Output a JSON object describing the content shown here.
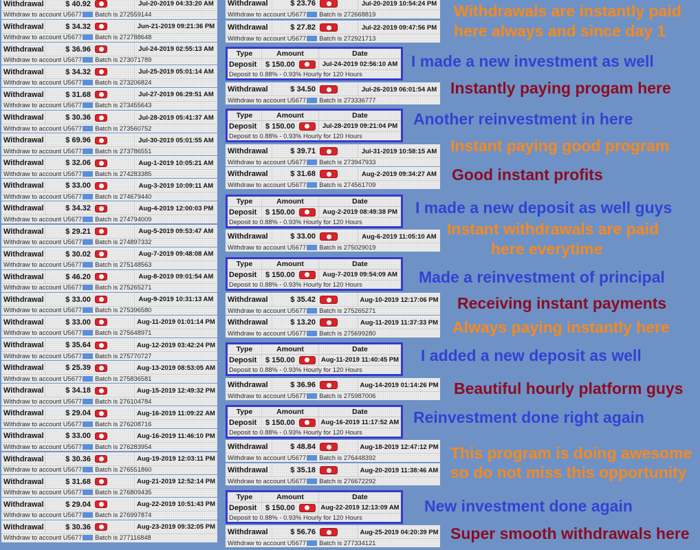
{
  "colors": {
    "page_background": "#6e92c6",
    "card_background": "#ededed",
    "deposit_border": "#3838cc",
    "account_redaction": "#5b8fd9",
    "payment_icon": "#d9232a"
  },
  "icons": {
    "payment": "perfect-money-icon"
  },
  "labels": {
    "withdrawal": "Withdrawal",
    "account": "Withdraw to account U5677",
    "deposit_type": "Deposit",
    "deposit_plan": "Deposit to 0.88% - 0.93% Hourly for 120 Hours"
  },
  "deposit_headers": {
    "type": "Type",
    "amount": "Amount",
    "date": "Date"
  },
  "left_withdrawals": [
    {
      "amount": "$ 40.92",
      "date": "Jul-20-2019 04:33:20 AM",
      "batch": "Batch is 272559144"
    },
    {
      "amount": "$ 34.32",
      "date": "Jun-21-2019 09:21:36 PM",
      "batch": "Batch is 272788648"
    },
    {
      "amount": "$ 36.96",
      "date": "Jul-24-2019 02:55:13 AM",
      "batch": "Batch is 273071789"
    },
    {
      "amount": "$ 34.32",
      "date": "Jul-25-2019 05:01:14 AM",
      "batch": "Batch is 273206824"
    },
    {
      "amount": "$ 31.68",
      "date": "Jul-27-2019 06:29:51 AM",
      "batch": "Batch is 273455643"
    },
    {
      "amount": "$ 30.36",
      "date": "Jul-28-2019 05:41:37 AM",
      "batch": "Batch is 273560752"
    },
    {
      "amount": "$ 69.96",
      "date": "Jul-30-2019 05:01:55 AM",
      "batch": "Batch is 273786551"
    },
    {
      "amount": "$ 32.06",
      "date": "Aug-1-2019 10:05:21 AM",
      "batch": "Batch is 274283385"
    },
    {
      "amount": "$ 33.00",
      "date": "Aug-3-2019 10:09:11 AM",
      "batch": "Batch is 274679440"
    },
    {
      "amount": "$ 34.32",
      "date": "Aug-4-2019 12:00:03 PM",
      "batch": "Batch is 274794009"
    },
    {
      "amount": "$ 29.21",
      "date": "Aug-5-2019 09:53:47 AM",
      "batch": "Batch is 274897332"
    },
    {
      "amount": "$ 30.02",
      "date": "Aug-7-2019 09:48:08 AM",
      "batch": "Batch is 275148563"
    },
    {
      "amount": "$ 46.20",
      "date": "Aug-8-2019 09:01:54 AM",
      "batch": "Batch is 275265271"
    },
    {
      "amount": "$ 33.00",
      "date": "Aug-9-2019 10:31:13 AM",
      "batch": "Batch is 275396580"
    },
    {
      "amount": "$ 33.00",
      "date": "Aug-11-2019 01:01:14 PM",
      "batch": "Batch is 275648971"
    },
    {
      "amount": "$ 35.64",
      "date": "Aug-12-2019 03:42:24 PM",
      "batch": "Batch is 275770727"
    },
    {
      "amount": "$ 25.39",
      "date": "Aug-13-2019 08:53:05 AM",
      "batch": "Batch is 275836581"
    },
    {
      "amount": "$ 34.18",
      "date": "Aug-15-2019 12:49:32 PM",
      "batch": "Batch is 276104784"
    },
    {
      "amount": "$ 29.04",
      "date": "Aug-16-2019 11:09:22 AM",
      "batch": "Batch is 276208716"
    },
    {
      "amount": "$ 33.00",
      "date": "Aug-16-2019 11:46:10 PM",
      "batch": "Batch is 276283954"
    },
    {
      "amount": "$ 30.36",
      "date": "Aug-19-2019 12:03:11 PM",
      "batch": "Batch is 276551860"
    },
    {
      "amount": "$ 31.68",
      "date": "Aug-21-2019 12:52:14 PM",
      "batch": "Batch is 276809435"
    },
    {
      "amount": "$ 29.04",
      "date": "Aug-22-2019 10:51:43 PM",
      "batch": "Batch is 276997874"
    },
    {
      "amount": "$ 30.36",
      "date": "Aug-23-2019 09:32:05 PM",
      "batch": "Batch is 277116848"
    }
  ],
  "middle_feed": [
    {
      "amount": "$ 23.76",
      "date": "Jul-20-2019 10:54:24 PM",
      "batch": "Batch is 272668819"
    },
    {
      "amount": "$ 27.82",
      "date": "Jul-22-2019 09:47:56 PM",
      "batch": "Batch is 272921713"
    },
    {
      "amount": "$ 150.00",
      "date": "Jul-24-2019 02:56:10 AM"
    },
    {
      "amount": "$ 34.50",
      "date": "Jul-26-2019 06:01:54 AM",
      "batch": "Batch is 273336777"
    },
    {
      "amount": "$ 150.00",
      "date": "Jul-28-2019 09:21:04 PM"
    },
    {
      "amount": "$ 39.71",
      "date": "Jul-31-2019 10:58:15 AM",
      "batch": "Batch is 273947933"
    },
    {
      "amount": "$ 31.68",
      "date": "Aug-2-2019 09:34:27 AM",
      "batch": "Batch is 274561709"
    },
    {
      "amount": "$ 150.00",
      "date": "Aug-2-2019 08:49:38 PM"
    },
    {
      "amount": "$ 33.00",
      "date": "Aug-6-2019 11:05:10 AM",
      "batch": "Batch is 275029019"
    },
    {
      "amount": "$ 150.00",
      "date": "Aug-7-2019 09:54:09 AM"
    },
    {
      "amount": "$ 35.42",
      "date": "Aug-10-2019 12:17:06 PM",
      "batch": "Batch is 275265271"
    },
    {
      "amount": "$ 13.20",
      "date": "Aug-11-2019 11:37:33 PM",
      "batch": "Batch is 275699280"
    },
    {
      "amount": "$ 150.00",
      "date": "Aug-11-2019 11:40:45 PM"
    },
    {
      "amount": "$ 36.96",
      "date": "Aug-14-2019 01:14:26 PM",
      "batch": "Batch is 275987006"
    },
    {
      "amount": "$ 150.00",
      "date": "Aug-16-2019 11:17:52 AM"
    },
    {
      "amount": "$ 48.84",
      "date": "Aug-18-2019 12:47:12 PM",
      "batch": "Batch is 276448392"
    },
    {
      "amount": "$ 35.18",
      "date": "Aug-20-2019 11:38:46 AM",
      "batch": "Batch is 276672292"
    },
    {
      "amount": "$ 150.00",
      "date": "Aug-22-2019 12:13:09 AM"
    },
    {
      "amount": "$ 56.76",
      "date": "Aug-25-2019 04:20:39 PM",
      "batch": "Batch is 277334121"
    }
  ],
  "annotations": [
    {
      "text": "Withdrawals are instantly paid",
      "color": "#f58a1f"
    },
    {
      "text": "here always and since day 1",
      "color": "#f58a1f"
    },
    {
      "text": "I made a new investment as well",
      "color": "#3143d2"
    },
    {
      "text": "Instantly paying progam here",
      "color": "#8c0d22"
    },
    {
      "text": "Another reinvestment in here",
      "color": "#3143d2"
    },
    {
      "text": "Instant paying good program",
      "color": "#f58a1f"
    },
    {
      "text": "Good instant profits",
      "color": "#8c0d22"
    },
    {
      "text": "I made a new deposit as well guys",
      "color": "#3143d2"
    },
    {
      "text": "Instant withdrawals are paid",
      "color": "#f58a1f"
    },
    {
      "text": "here everytime",
      "color": "#f58a1f"
    },
    {
      "text": "Made a reinvestment of principal",
      "color": "#3143d2"
    },
    {
      "text": "Receiving instant payments",
      "color": "#8c0d22"
    },
    {
      "text": "Always paying instantly here",
      "color": "#f58a1f"
    },
    {
      "text": "I added a new deposit as well",
      "color": "#3143d2"
    },
    {
      "text": "Beautiful hourly platform guys",
      "color": "#8c0d22"
    },
    {
      "text": "Reinvestment done right again",
      "color": "#3143d2"
    },
    {
      "text": "This program is doing awesome",
      "color": "#f58a1f"
    },
    {
      "text": "so do not miss this opportunity",
      "color": "#f58a1f"
    },
    {
      "text": "New investment done again",
      "color": "#3143d2"
    },
    {
      "text": "Super smooth withdrawals here",
      "color": "#8c0d22"
    }
  ]
}
